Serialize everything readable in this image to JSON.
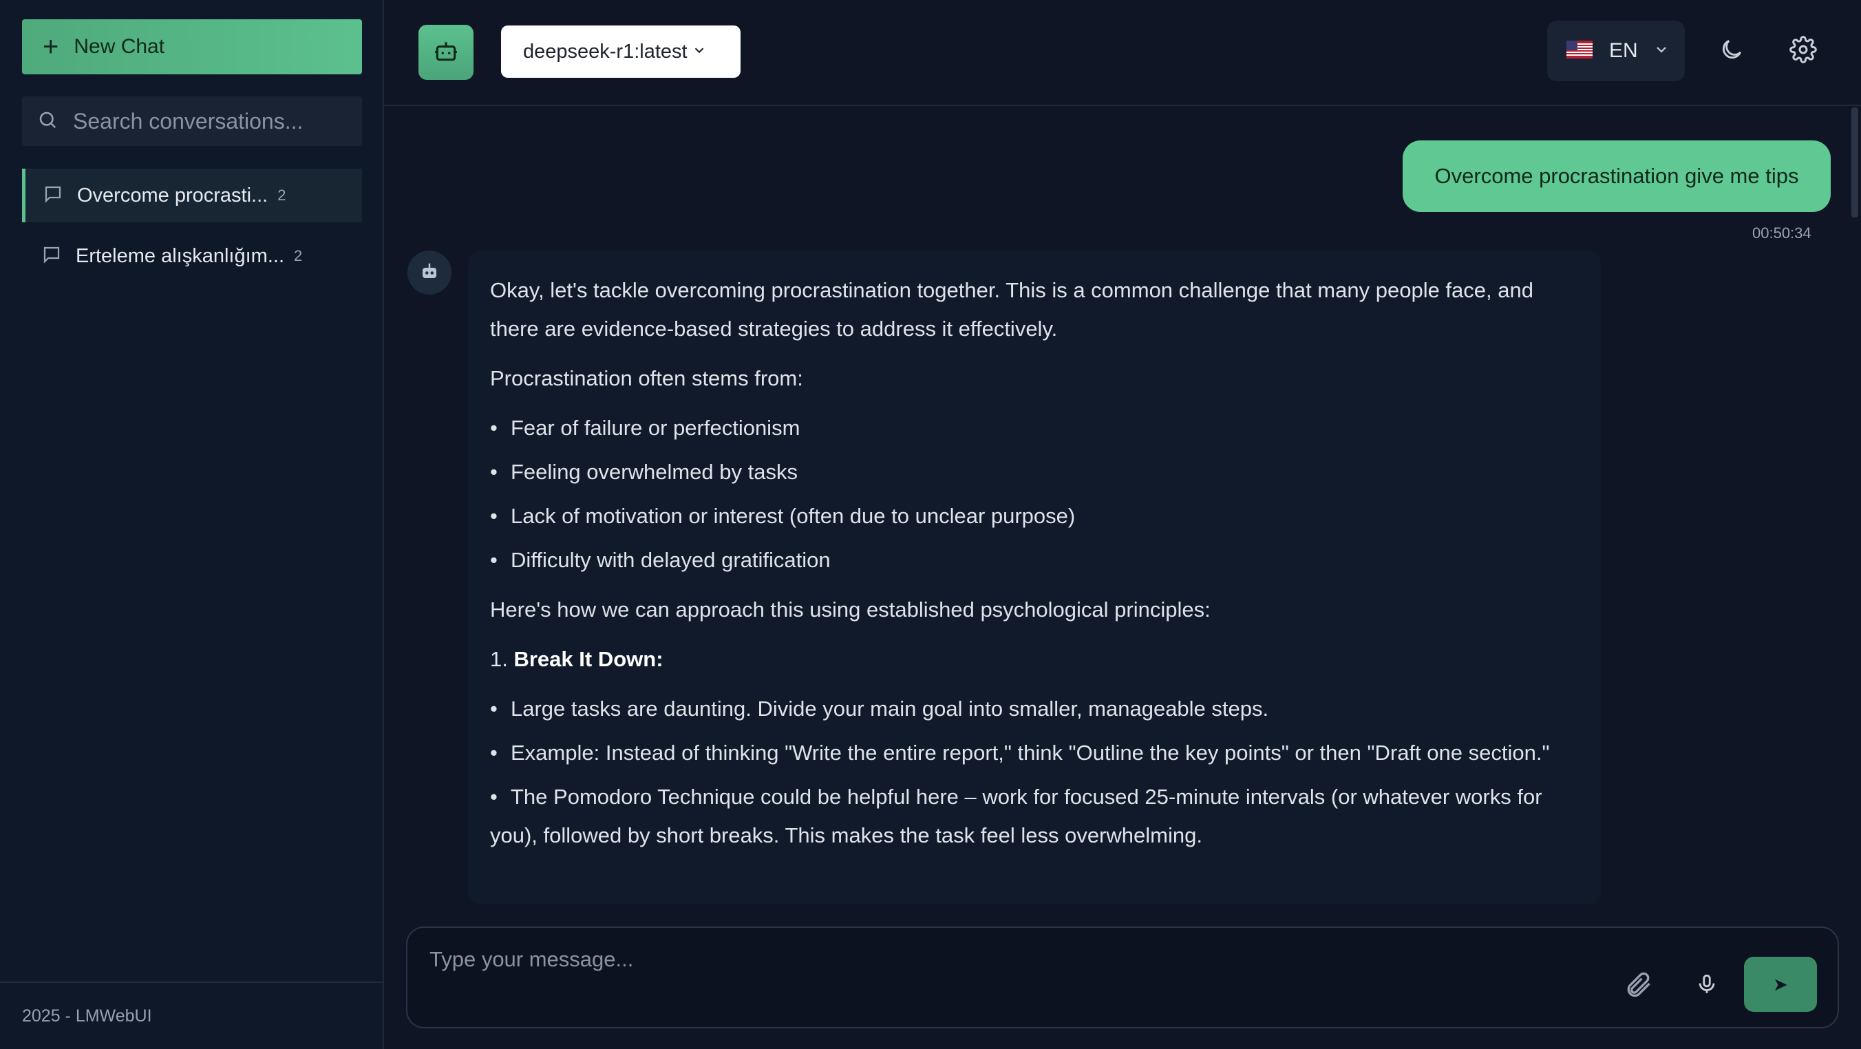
{
  "sidebar": {
    "new_chat_label": "New Chat",
    "search_placeholder": "Search conversations...",
    "conversations": [
      {
        "title": "Overcome procrasti...",
        "count": "2"
      },
      {
        "title": "Erteleme alışkanlığım...",
        "count": "2"
      }
    ],
    "footer": "2025 - LMWebUI"
  },
  "header": {
    "model": "deepseek-r1:latest",
    "language_code": "EN"
  },
  "chat": {
    "user_message": "Overcome procrastination give me tips",
    "user_timestamp": "00:50:34",
    "assistant": {
      "intro": "Okay, let's tackle overcoming procrastination together. This is a common challenge that many people face, and there are evidence-based strategies to address it effectively.",
      "stems_heading": "Procrastination often stems from:",
      "stems": [
        "Fear of failure or perfectionism",
        "Feeling overwhelmed by tasks",
        "Lack of motivation or interest (often due to unclear purpose)",
        "Difficulty with delayed gratification"
      ],
      "approach_heading": "Here's how we can approach this using established psychological principles:",
      "step1_number": "1.",
      "step1_title": "Break It Down:",
      "step1_bullets": [
        "Large tasks are daunting. Divide your main goal into smaller, manageable steps.",
        "Example: Instead of thinking \"Write the entire report,\" think \"Outline the key points\" or then \"Draft one section.\"",
        "The Pomodoro Technique could be helpful here – work for focused 25-minute intervals (or whatever works for you), followed by short breaks. This makes the task feel less overwhelming."
      ]
    }
  },
  "composer": {
    "placeholder": "Type your message...",
    "send_icon": "➤"
  },
  "colors": {
    "accent": "#5cc08e",
    "background": "#0f1524",
    "sidebar": "#0f1829"
  }
}
